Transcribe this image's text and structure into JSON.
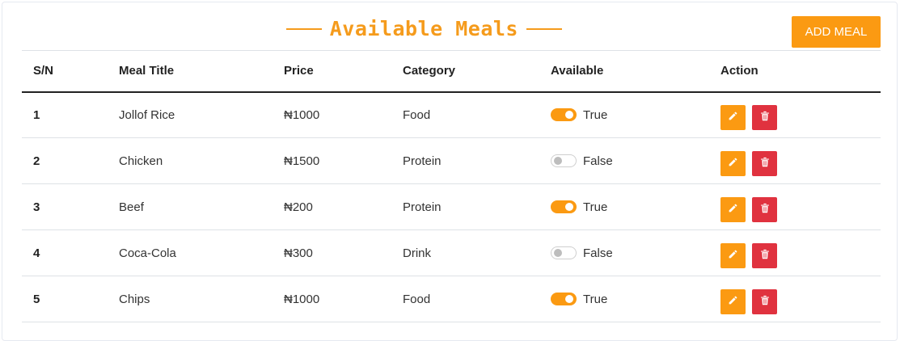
{
  "header": {
    "title": "Available Meals",
    "add_button_label": "ADD MEAL"
  },
  "table": {
    "columns": [
      "S/N",
      "Meal Title",
      "Price",
      "Category",
      "Available",
      "Action"
    ],
    "rows": [
      {
        "sn": "1",
        "title": "Jollof Rice",
        "price": "₦1000",
        "category": "Food",
        "available": true,
        "available_label": "True"
      },
      {
        "sn": "2",
        "title": "Chicken",
        "price": "₦1500",
        "category": "Protein",
        "available": false,
        "available_label": "False"
      },
      {
        "sn": "3",
        "title": "Beef",
        "price": "₦200",
        "category": "Protein",
        "available": true,
        "available_label": "True"
      },
      {
        "sn": "4",
        "title": "Coca-Cola",
        "price": "₦300",
        "category": "Drink",
        "available": false,
        "available_label": "False"
      },
      {
        "sn": "5",
        "title": "Chips",
        "price": "₦1000",
        "category": "Food",
        "available": true,
        "available_label": "True"
      }
    ]
  },
  "icons": {
    "edit": "pencil-icon",
    "delete": "trash-icon"
  },
  "colors": {
    "accent": "#fb9a12",
    "title": "#f59b1c",
    "danger": "#e0323f"
  }
}
